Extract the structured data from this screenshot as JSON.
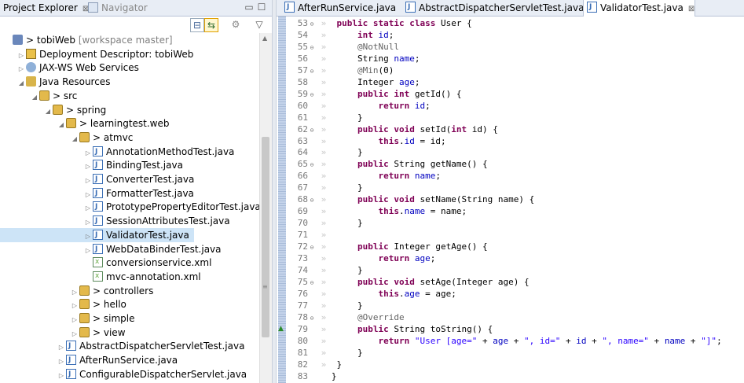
{
  "left_panel": {
    "tabs": [
      {
        "label": "Project Explorer",
        "close": "⊠",
        "active": true
      },
      {
        "label": "Navigator",
        "active": false
      }
    ],
    "window_buttons": {
      "minimize": "▭",
      "maximize": "☐"
    },
    "toolbar": {
      "collapse_all": "⊟",
      "link_editor": "⇆",
      "more": "⚙",
      "view_menu": "▽"
    },
    "tree": [
      {
        "indent": 0,
        "arrow": "",
        "icon": "project",
        "label": "> tobiWeb",
        "extra": "[workspace master]"
      },
      {
        "indent": 1,
        "arrow": "▷",
        "icon": "dd",
        "label": "Deployment Descriptor: tobiWeb"
      },
      {
        "indent": 1,
        "arrow": "▷",
        "icon": "ws",
        "label": "JAX-WS Web Services"
      },
      {
        "indent": 1,
        "arrow": "◢",
        "icon": "jr",
        "label": "Java Resources"
      },
      {
        "indent": 2,
        "arrow": "◢",
        "icon": "pkg",
        "label": "> src"
      },
      {
        "indent": 3,
        "arrow": "◢",
        "icon": "pkg",
        "label": "> spring"
      },
      {
        "indent": 4,
        "arrow": "◢",
        "icon": "pkg",
        "label": "> learningtest.web"
      },
      {
        "indent": 5,
        "arrow": "◢",
        "icon": "pkg",
        "label": "> atmvc"
      },
      {
        "indent": 6,
        "arrow": "▷",
        "icon": "java",
        "label": "AnnotationMethodTest.java"
      },
      {
        "indent": 6,
        "arrow": "▷",
        "icon": "java",
        "label": "BindingTest.java"
      },
      {
        "indent": 6,
        "arrow": "▷",
        "icon": "java",
        "label": "ConverterTest.java"
      },
      {
        "indent": 6,
        "arrow": "▷",
        "icon": "java",
        "label": "FormatterTest.java"
      },
      {
        "indent": 6,
        "arrow": "▷",
        "icon": "java",
        "label": "PrototypePropertyEditorTest.java"
      },
      {
        "indent": 6,
        "arrow": "▷",
        "icon": "java",
        "label": "SessionAttributesTest.java"
      },
      {
        "indent": 6,
        "arrow": "▷",
        "icon": "java",
        "label": "ValidatorTest.java",
        "selected": true
      },
      {
        "indent": 6,
        "arrow": "▷",
        "icon": "java",
        "label": "WebDataBinderTest.java"
      },
      {
        "indent": 6,
        "arrow": "",
        "icon": "xml",
        "label": "conversionservice.xml"
      },
      {
        "indent": 6,
        "arrow": "",
        "icon": "xml",
        "label": "mvc-annotation.xml"
      },
      {
        "indent": 5,
        "arrow": "▷",
        "icon": "pkg",
        "label": "> controllers"
      },
      {
        "indent": 5,
        "arrow": "▷",
        "icon": "pkg",
        "label": "> hello"
      },
      {
        "indent": 5,
        "arrow": "▷",
        "icon": "pkg",
        "label": "> simple"
      },
      {
        "indent": 5,
        "arrow": "▷",
        "icon": "pkg",
        "label": "> view"
      },
      {
        "indent": 4,
        "arrow": "▷",
        "icon": "java",
        "label": "AbstractDispatcherServletTest.java"
      },
      {
        "indent": 4,
        "arrow": "▷",
        "icon": "java",
        "label": "AfterRunService.java"
      },
      {
        "indent": 4,
        "arrow": "▷",
        "icon": "java",
        "label": "ConfigurableDispatcherServlet.java"
      }
    ],
    "scrollbar": {
      "up_arrow": "▲",
      "grip": "≡"
    }
  },
  "editor": {
    "tabs": [
      {
        "label": "AfterRunService.java",
        "active": false
      },
      {
        "label": "AbstractDispatcherServletTest.java",
        "active": false
      },
      {
        "label": "ValidatorTest.java",
        "active": true,
        "close": "⊠"
      }
    ],
    "override_marker": "▲",
    "lines": [
      {
        "n": "53",
        "fold": "⊖",
        "guide": "»",
        "code": [
          [
            "t",
            " "
          ],
          [
            "k",
            "public"
          ],
          [
            "t",
            " "
          ],
          [
            "k",
            "static"
          ],
          [
            "t",
            " "
          ],
          [
            "k",
            "class"
          ],
          [
            "t",
            " User {"
          ]
        ]
      },
      {
        "n": "54",
        "guide": "»",
        "code": [
          [
            "t",
            "     "
          ],
          [
            "k",
            "int"
          ],
          [
            "t",
            " "
          ],
          [
            "f",
            "id"
          ],
          [
            "t",
            ";"
          ]
        ]
      },
      {
        "n": "55",
        "fold": "⊖",
        "guide": "»",
        "code": [
          [
            "t",
            "     "
          ],
          [
            "a",
            "@NotNull"
          ]
        ]
      },
      {
        "n": "56",
        "guide": "»",
        "code": [
          [
            "t",
            "     String "
          ],
          [
            "f",
            "name"
          ],
          [
            "t",
            ";"
          ]
        ]
      },
      {
        "n": "57",
        "fold": "⊖",
        "guide": "»",
        "code": [
          [
            "t",
            "     "
          ],
          [
            "a",
            "@Min"
          ],
          [
            "t",
            "(0)"
          ]
        ]
      },
      {
        "n": "58",
        "guide": "»",
        "code": [
          [
            "t",
            "     Integer "
          ],
          [
            "f",
            "age"
          ],
          [
            "t",
            ";"
          ]
        ]
      },
      {
        "n": "59",
        "fold": "⊖",
        "guide": "»",
        "code": [
          [
            "t",
            "     "
          ],
          [
            "k",
            "public"
          ],
          [
            "t",
            " "
          ],
          [
            "k",
            "int"
          ],
          [
            "t",
            " getId() {"
          ]
        ]
      },
      {
        "n": "60",
        "guide": "»",
        "code": [
          [
            "t",
            "         "
          ],
          [
            "k",
            "return"
          ],
          [
            "t",
            " "
          ],
          [
            "f",
            "id"
          ],
          [
            "t",
            ";"
          ]
        ]
      },
      {
        "n": "61",
        "guide": "»",
        "code": [
          [
            "t",
            "     }"
          ]
        ]
      },
      {
        "n": "62",
        "fold": "⊖",
        "guide": "»",
        "code": [
          [
            "t",
            "     "
          ],
          [
            "k",
            "public"
          ],
          [
            "t",
            " "
          ],
          [
            "k",
            "void"
          ],
          [
            "t",
            " setId("
          ],
          [
            "k",
            "int"
          ],
          [
            "t",
            " id) {"
          ]
        ]
      },
      {
        "n": "63",
        "guide": "»",
        "code": [
          [
            "t",
            "         "
          ],
          [
            "k",
            "this"
          ],
          [
            "t",
            "."
          ],
          [
            "f",
            "id"
          ],
          [
            "t",
            " = id;"
          ]
        ]
      },
      {
        "n": "64",
        "guide": "»",
        "code": [
          [
            "t",
            "     }"
          ]
        ]
      },
      {
        "n": "65",
        "fold": "⊖",
        "guide": "»",
        "code": [
          [
            "t",
            "     "
          ],
          [
            "k",
            "public"
          ],
          [
            "t",
            " String getName() {"
          ]
        ]
      },
      {
        "n": "66",
        "guide": "»",
        "code": [
          [
            "t",
            "         "
          ],
          [
            "k",
            "return"
          ],
          [
            "t",
            " "
          ],
          [
            "f",
            "name"
          ],
          [
            "t",
            ";"
          ]
        ]
      },
      {
        "n": "67",
        "guide": "»",
        "code": [
          [
            "t",
            "     }"
          ]
        ]
      },
      {
        "n": "68",
        "fold": "⊖",
        "guide": "»",
        "code": [
          [
            "t",
            "     "
          ],
          [
            "k",
            "public"
          ],
          [
            "t",
            " "
          ],
          [
            "k",
            "void"
          ],
          [
            "t",
            " setName(String name) {"
          ]
        ]
      },
      {
        "n": "69",
        "guide": "»",
        "code": [
          [
            "t",
            "         "
          ],
          [
            "k",
            "this"
          ],
          [
            "t",
            "."
          ],
          [
            "f",
            "name"
          ],
          [
            "t",
            " = name;"
          ]
        ]
      },
      {
        "n": "70",
        "guide": "»",
        "code": [
          [
            "t",
            "     }"
          ]
        ]
      },
      {
        "n": "71",
        "guide": "»",
        "code": [
          [
            "t",
            ""
          ]
        ]
      },
      {
        "n": "72",
        "fold": "⊖",
        "guide": "»",
        "code": [
          [
            "t",
            "     "
          ],
          [
            "k",
            "public"
          ],
          [
            "t",
            " Integer getAge() {"
          ]
        ]
      },
      {
        "n": "73",
        "guide": "»",
        "code": [
          [
            "t",
            "         "
          ],
          [
            "k",
            "return"
          ],
          [
            "t",
            " "
          ],
          [
            "f",
            "age"
          ],
          [
            "t",
            ";"
          ]
        ]
      },
      {
        "n": "74",
        "guide": "»",
        "code": [
          [
            "t",
            "     }"
          ]
        ]
      },
      {
        "n": "75",
        "fold": "⊖",
        "guide": "»",
        "code": [
          [
            "t",
            "     "
          ],
          [
            "k",
            "public"
          ],
          [
            "t",
            " "
          ],
          [
            "k",
            "void"
          ],
          [
            "t",
            " setAge(Integer age) {"
          ]
        ]
      },
      {
        "n": "76",
        "guide": "»",
        "code": [
          [
            "t",
            "         "
          ],
          [
            "k",
            "this"
          ],
          [
            "t",
            "."
          ],
          [
            "f",
            "age"
          ],
          [
            "t",
            " = age;"
          ]
        ]
      },
      {
        "n": "77",
        "guide": "»",
        "code": [
          [
            "t",
            "     }"
          ]
        ]
      },
      {
        "n": "78",
        "fold": "⊖",
        "guide": "»",
        "code": [
          [
            "t",
            "     "
          ],
          [
            "a",
            "@Override"
          ]
        ]
      },
      {
        "n": "79",
        "guide": "»",
        "code": [
          [
            "t",
            "     "
          ],
          [
            "k",
            "public"
          ],
          [
            "t",
            " String toString() {"
          ]
        ]
      },
      {
        "n": "80",
        "guide": "»",
        "code": [
          [
            "t",
            "         "
          ],
          [
            "k",
            "return"
          ],
          [
            "t",
            " "
          ],
          [
            "s",
            "\"User [age=\""
          ],
          [
            "t",
            " + "
          ],
          [
            "f",
            "age"
          ],
          [
            "t",
            " + "
          ],
          [
            "s",
            "\", id=\""
          ],
          [
            "t",
            " + "
          ],
          [
            "f",
            "id"
          ],
          [
            "t",
            " + "
          ],
          [
            "s",
            "\", name=\""
          ],
          [
            "t",
            " + "
          ],
          [
            "f",
            "name"
          ],
          [
            "t",
            " + "
          ],
          [
            "s",
            "\"]\""
          ],
          [
            "t",
            ";"
          ]
        ]
      },
      {
        "n": "81",
        "guide": "»",
        "code": [
          [
            "t",
            "     }"
          ]
        ]
      },
      {
        "n": "82",
        "guide": "»",
        "code": [
          [
            "t",
            " }"
          ]
        ]
      },
      {
        "n": "83",
        "code": [
          [
            "t",
            "}"
          ]
        ]
      }
    ]
  }
}
